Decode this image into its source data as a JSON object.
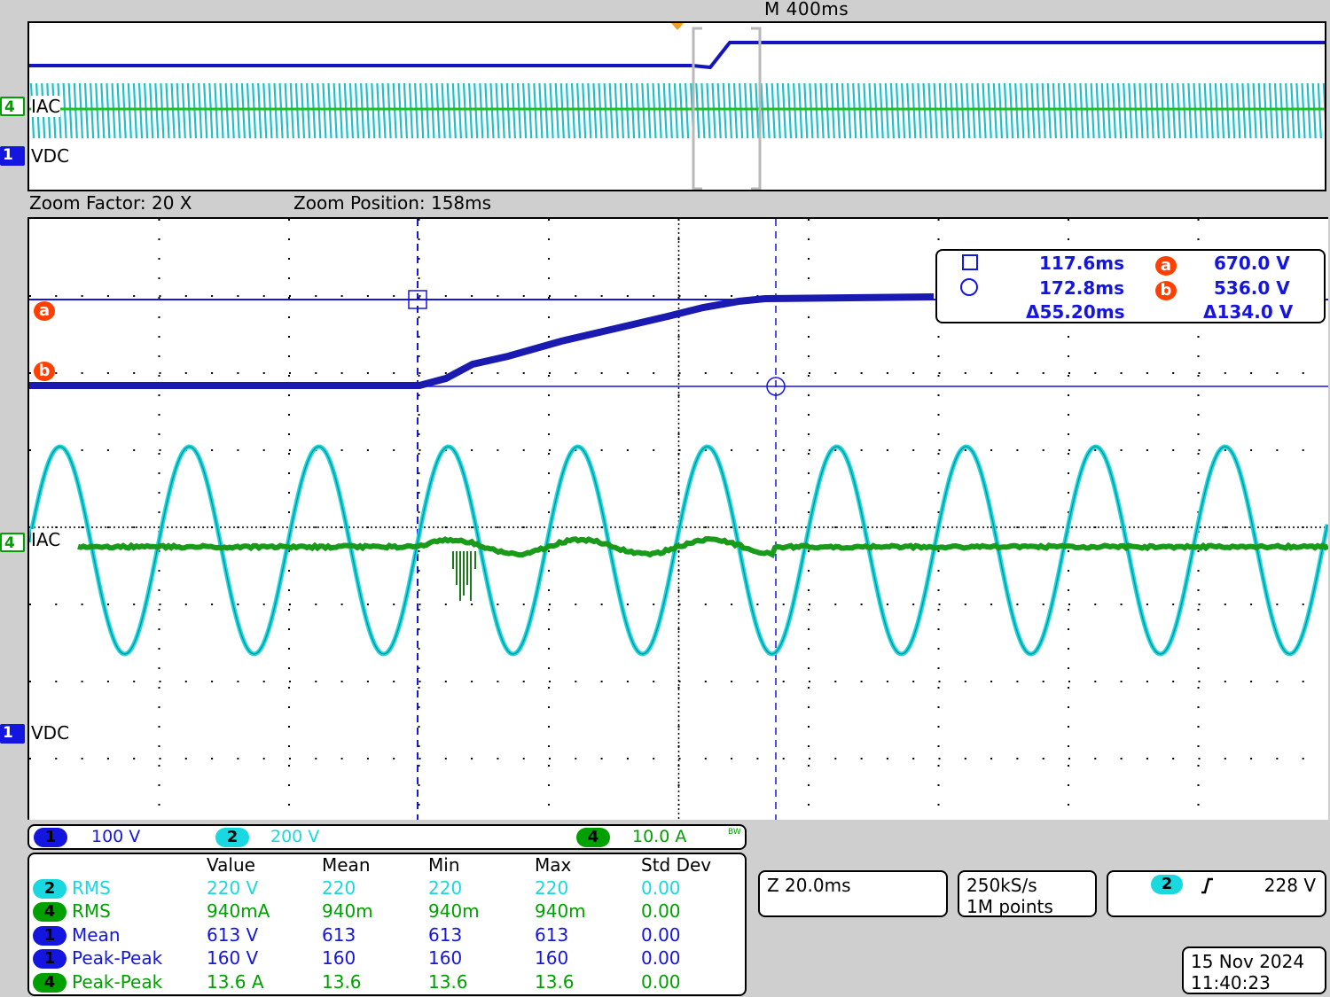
{
  "header": {
    "timebase": "M 400ms",
    "zoom_factor": "Zoom Factor: 20 X",
    "zoom_position": "Zoom Position: 158ms"
  },
  "channels": {
    "ch4": {
      "number": "4",
      "label": "IAC",
      "color": "#00a000"
    },
    "ch1": {
      "number": "1",
      "label": "VDC",
      "color": "#1515e0"
    },
    "ch2": {
      "number": "2",
      "color": "#19d8e0"
    }
  },
  "cursor_readout": {
    "cursor1_time": "117.6ms",
    "cursor2_time": "172.8ms",
    "delta_time": "Δ55.20ms",
    "cursor_a_label": "a",
    "cursor_a_value": "670.0 V",
    "cursor_b_label": "b",
    "cursor_b_value": "536.0 V",
    "delta_value": "Δ134.0 V"
  },
  "scale_bar": {
    "ch1": {
      "num": "1",
      "scale": "100 V"
    },
    "ch2": {
      "num": "2",
      "scale": "200 V"
    },
    "ch4": {
      "num": "4",
      "scale": "10.0 A",
      "bw_icon": "BW"
    }
  },
  "measurements": {
    "headers": [
      "Value",
      "Mean",
      "Min",
      "Max",
      "Std Dev"
    ],
    "rows": [
      {
        "ch": "2",
        "name": "RMS",
        "value": "220 V",
        "mean": "220",
        "min": "220",
        "max": "220",
        "std": "0.00",
        "color": "#19d8e0"
      },
      {
        "ch": "4",
        "name": "RMS",
        "value": "940mA",
        "mean": "940m",
        "min": "940m",
        "max": "940m",
        "std": "0.00",
        "color": "#00a000"
      },
      {
        "ch": "1",
        "name": "Mean",
        "value": "613 V",
        "mean": "613",
        "min": "613",
        "max": "613",
        "std": "0.00",
        "color": "#1515e0"
      },
      {
        "ch": "1",
        "name": "Peak-Peak",
        "value": "160 V",
        "mean": "160",
        "min": "160",
        "max": "160",
        "std": "0.00",
        "color": "#1515e0"
      },
      {
        "ch": "4",
        "name": "Peak-Peak",
        "value": "13.6 A",
        "mean": "13.6",
        "min": "13.6",
        "max": "13.6",
        "std": "0.00",
        "color": "#00a000"
      }
    ]
  },
  "horizontal": {
    "zoom_scale": "Z 20.0ms"
  },
  "acquisition": {
    "sample_rate": "250kS/s",
    "record_length": "1M points"
  },
  "trigger": {
    "source": "2",
    "slope_icon": "rising-edge",
    "level": "228 V"
  },
  "datetime": {
    "date": "15 Nov 2024",
    "time": "11:40:23"
  }
}
